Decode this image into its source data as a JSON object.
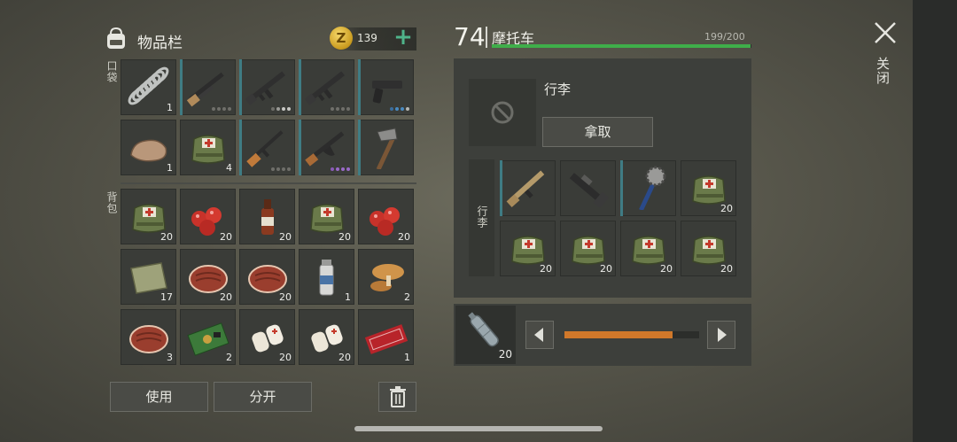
{
  "inventory": {
    "title": "物品栏",
    "coins": "139",
    "coin_symbol": "Z",
    "plus": "+",
    "pocket_label": "口袋",
    "backpack_label": "背包",
    "pocket": [
      {
        "name": "spring-item",
        "count": "1",
        "teal": false,
        "dots": 0
      },
      {
        "name": "shotgun-item",
        "count": "",
        "teal": true,
        "dots": 4
      },
      {
        "name": "assault-rifle-item",
        "count": "",
        "teal": true,
        "dots": 4
      },
      {
        "name": "assault-rifle-item",
        "count": "",
        "teal": true,
        "dots": 4
      },
      {
        "name": "pistol-item",
        "count": "",
        "teal": true,
        "dots": 4
      },
      {
        "name": "stone-item",
        "count": "1",
        "teal": false,
        "dots": 0
      },
      {
        "name": "medkit-bag-item",
        "count": "4",
        "teal": false,
        "dots": 0
      },
      {
        "name": "rifle-item",
        "count": "",
        "teal": true,
        "dots": 4
      },
      {
        "name": "ak-rifle-item",
        "count": "",
        "teal": true,
        "dots": 4
      },
      {
        "name": "hatchet-item",
        "count": "",
        "teal": true,
        "dots": 0
      }
    ],
    "backpack": [
      {
        "name": "medkit-bag-item",
        "count": "20"
      },
      {
        "name": "berries-item",
        "count": "20"
      },
      {
        "name": "bottle-item",
        "count": "20"
      },
      {
        "name": "medkit-bag-item",
        "count": "20"
      },
      {
        "name": "berries-item",
        "count": "20"
      },
      {
        "name": "cloth-item",
        "count": "17"
      },
      {
        "name": "steak-item",
        "count": "20"
      },
      {
        "name": "steak-item",
        "count": "20"
      },
      {
        "name": "spray-can-item",
        "count": "1"
      },
      {
        "name": "mushroom-item",
        "count": "2"
      },
      {
        "name": "steak-item",
        "count": "3"
      },
      {
        "name": "circuit-board-item",
        "count": "2"
      },
      {
        "name": "bandage-item",
        "count": "20"
      },
      {
        "name": "bandage-item",
        "count": "20"
      },
      {
        "name": "coupon-item",
        "count": "1"
      }
    ],
    "use_button": "使用",
    "split_button": "分开"
  },
  "vehicle": {
    "level": "74",
    "name": "摩托车",
    "durability": "199/200",
    "durability_fraction": 0.995,
    "luggage_title": "行李",
    "take_button": "拿取",
    "luggage_label": "行李",
    "luggage": [
      {
        "name": "scar-rifle-item",
        "count": "",
        "teal": true
      },
      {
        "name": "blunderbuss-item",
        "count": "",
        "teal": false
      },
      {
        "name": "saw-mace-item",
        "count": "",
        "teal": true
      },
      {
        "name": "medkit-bag-item",
        "count": "20",
        "teal": false
      },
      {
        "name": "medkit-bag-item",
        "count": "20",
        "teal": false
      },
      {
        "name": "medkit-bag-item",
        "count": "20",
        "teal": false
      },
      {
        "name": "medkit-bag-item",
        "count": "20",
        "teal": false
      },
      {
        "name": "medkit-bag-item",
        "count": "20",
        "teal": false
      }
    ],
    "fuel_count": "20",
    "fuel_fraction": 0.8
  },
  "close_label": "关闭",
  "colors": {
    "hp_bar": "#3fae4a",
    "fuel_bar": "#d0782a",
    "teal": "#3f7c84",
    "plus": "#4fb38a"
  }
}
